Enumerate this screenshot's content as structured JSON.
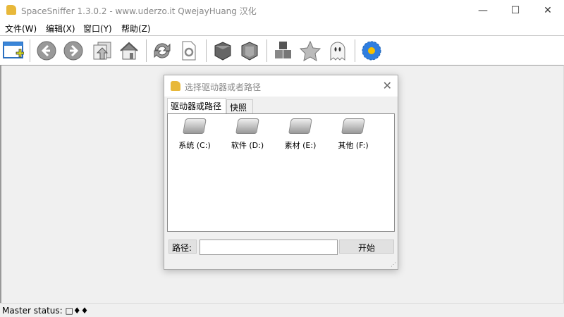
{
  "window": {
    "title": "SpaceSniffer 1.3.0.2 - www.uderzo.it  QwejayHuang 汉化",
    "minimize": "—",
    "maximize": "☐",
    "close": "✕"
  },
  "menu": [
    "文件(W)",
    "编辑(X)",
    "窗口(Y)",
    "帮助(Z)"
  ],
  "toolbar": [
    "new-window-icon",
    "back-icon",
    "forward-icon",
    "up-folder-icon",
    "home-icon",
    "refresh-icon",
    "refresh-document-icon",
    "cube-icon",
    "cube-alt-icon",
    "cubes-icon",
    "star-icon",
    "ghost-icon",
    "flower-icon"
  ],
  "dialog": {
    "title": "选择驱动器或者路径",
    "close": "✕",
    "tabs": [
      "驱动器或路径",
      "快照"
    ],
    "drives": [
      "系统 (C:)",
      "软件 (D:)",
      "素材 (E:)",
      "其他 (F:)"
    ],
    "path_label": "路径:",
    "path_value": "",
    "start": "开始"
  },
  "status": "Master status: □♦♦"
}
